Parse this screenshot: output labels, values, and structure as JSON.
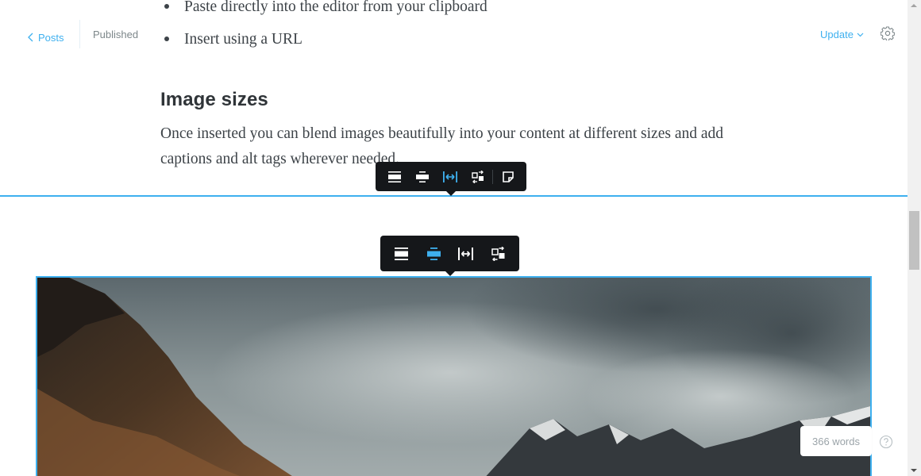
{
  "header": {
    "back_label": "Posts",
    "status": "Published",
    "update_label": "Update"
  },
  "content": {
    "list_items": [
      "Paste directly into the editor from your clipboard",
      "Insert using a URL"
    ],
    "heading": "Image sizes",
    "paragraph": "Once inserted you can blend images beautifully into your content at different sizes and add captions and alt tags wherever needed."
  },
  "footer": {
    "word_count": "366 words"
  },
  "colors": {
    "accent": "#3eb0ef",
    "toolbar_bg": "#15171a",
    "text": "#3d4348"
  },
  "icons": {
    "card_toolbar": [
      "image-regular-width-icon",
      "image-wide-width-icon",
      "image-full-width-icon",
      "replace-image-icon",
      "snippet-icon"
    ],
    "card_toolbar_active": "image-full-width-icon",
    "image_toolbar": [
      "image-regular-width-icon",
      "image-wide-width-icon",
      "image-full-width-icon",
      "replace-image-icon"
    ],
    "image_toolbar_active": "image-wide-width-icon"
  }
}
